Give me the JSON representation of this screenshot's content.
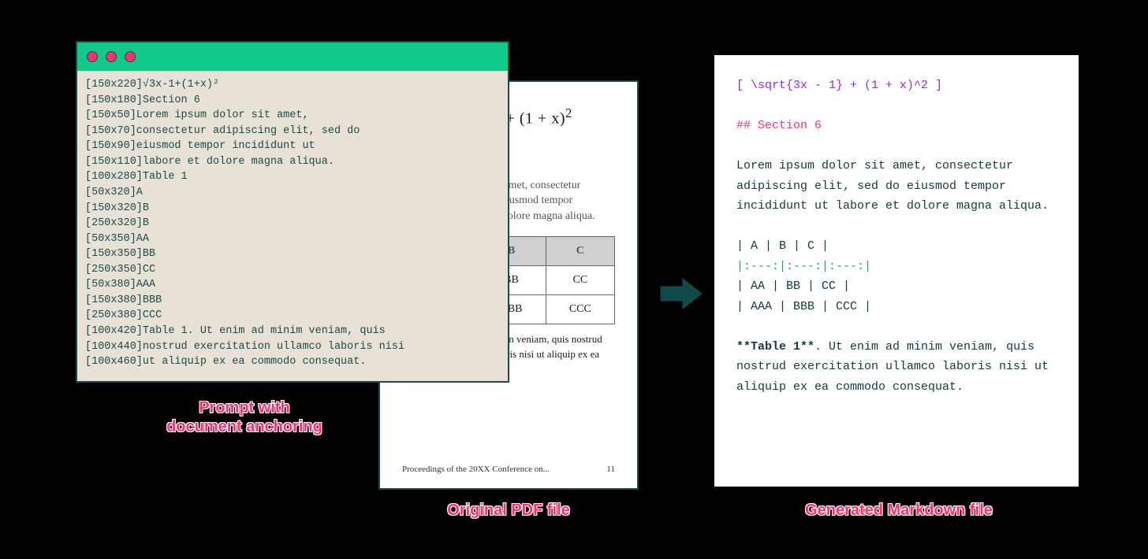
{
  "terminal": {
    "lines": [
      "[150x220]√3x-1+(1+x)²",
      "[150x180]Section 6",
      "[150x50]Lorem ipsum dolor sit amet,",
      "[150x70]consectetur adipiscing elit, sed do",
      "[150x90]eiusmod tempor incididunt ut",
      "[150x110]labore et dolore magna aliqua.",
      "[100x280]Table 1",
      "[50x320]A",
      "[150x320]B",
      "[250x320]B",
      "[50x350]AA",
      "[150x350]BB",
      "[250x350]CC",
      "[50x380]AAA",
      "[150x380]BBB",
      "[250x380]CCC",
      "[100x420]Table 1. Ut enim ad minim veniam, quis",
      "[100x440]nostrud exercitation ullamco laboris nisi",
      "[100x460]ut aliquip ex ea commodo consequat."
    ]
  },
  "pdf": {
    "eq_radicand": "3x − 1",
    "eq_tail": " + (1 + x)",
    "eq_exp": "2",
    "heading": "Section 6",
    "para": "Lorem ipsum dolor sit amet, consectetur adipiscing elit, sed do eiusmod tempor incididunt ut labore et dolore magna aliqua.",
    "table": {
      "headers": [
        "A",
        "B",
        "C"
      ],
      "rows": [
        [
          "AA",
          "BB",
          "CC"
        ],
        [
          "AAA",
          "BBB",
          "CCC"
        ]
      ]
    },
    "caption_label": "Table 1.",
    "caption_text": " Ut enim ad minim veniam, quis nostrud exercitation ullamco laboris nisi ut aliquip ex ea commodo consequat.",
    "footer_left": "Proceedings of the 20XX Conference on...",
    "footer_right": "11"
  },
  "md": {
    "latex": "[ \\sqrt{3x - 1} + (1 + x)^2 ]",
    "heading": "## Section 6",
    "para": "Lorem ipsum dolor sit amet, consectetur adipiscing elit, sed do eiusmod tempor incididunt ut labore et dolore magna aliqua.",
    "table": [
      "| A   | B   | C   |",
      "|:---:|:---:|:---:|",
      "| AA  | BB  | CC  |",
      "| AAA | BBB | CCC |"
    ],
    "caption_bold": "**Table 1**",
    "caption_rest": ". Ut enim ad minim veniam, quis nostrud exercitation ullamco laboris nisi ut aliquip ex ea commodo consequat."
  },
  "labels": {
    "l1": "Prompt with\ndocument anchoring",
    "l2": "Original PDF file",
    "l3": "Generated Markdown file"
  }
}
